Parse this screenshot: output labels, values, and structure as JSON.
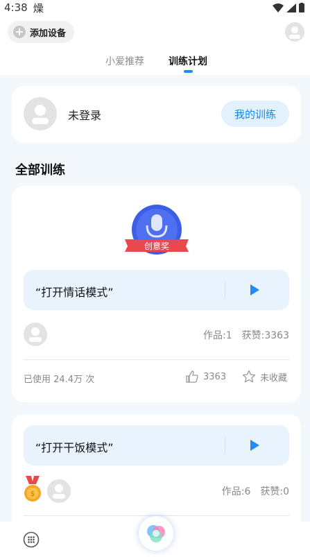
{
  "status_bar": {
    "time": "4:38",
    "notification_glyph": "燥"
  },
  "header": {
    "add_device_label": "添加设备",
    "tabs": [
      {
        "label": "小爱推荐",
        "active": false
      },
      {
        "label": "训练计划",
        "active": true
      }
    ]
  },
  "login_card": {
    "status_text": "未登录",
    "my_training_button": "我的训练"
  },
  "section_title": "全部训练",
  "trainings": [
    {
      "badge_text": "创意奖",
      "phrase": "“打开情话模式”",
      "works": "作品:1",
      "likes_total": "获赞:3363",
      "usage": "已使用 24.4万 次",
      "like_count": "3363",
      "favorite_label": "未收藏"
    },
    {
      "phrase": "“打开干饭模式”",
      "works": "作品:6",
      "likes_total": "获赞:0"
    }
  ],
  "icons": {
    "add": "plus-circle-icon",
    "profile": "user-avatar-icon",
    "play": "play-icon",
    "like": "thumbs-up-icon",
    "favorite": "star-icon",
    "medal": "gold-medal-icon",
    "grid": "app-grid-icon",
    "assistant": "xiaoai-orb-icon"
  },
  "colors": {
    "accent": "#1e8cf0",
    "badge_blue": "#3c5ee6",
    "badge_ribbon": "#e9494e",
    "medal_gold": "#f5a623"
  }
}
